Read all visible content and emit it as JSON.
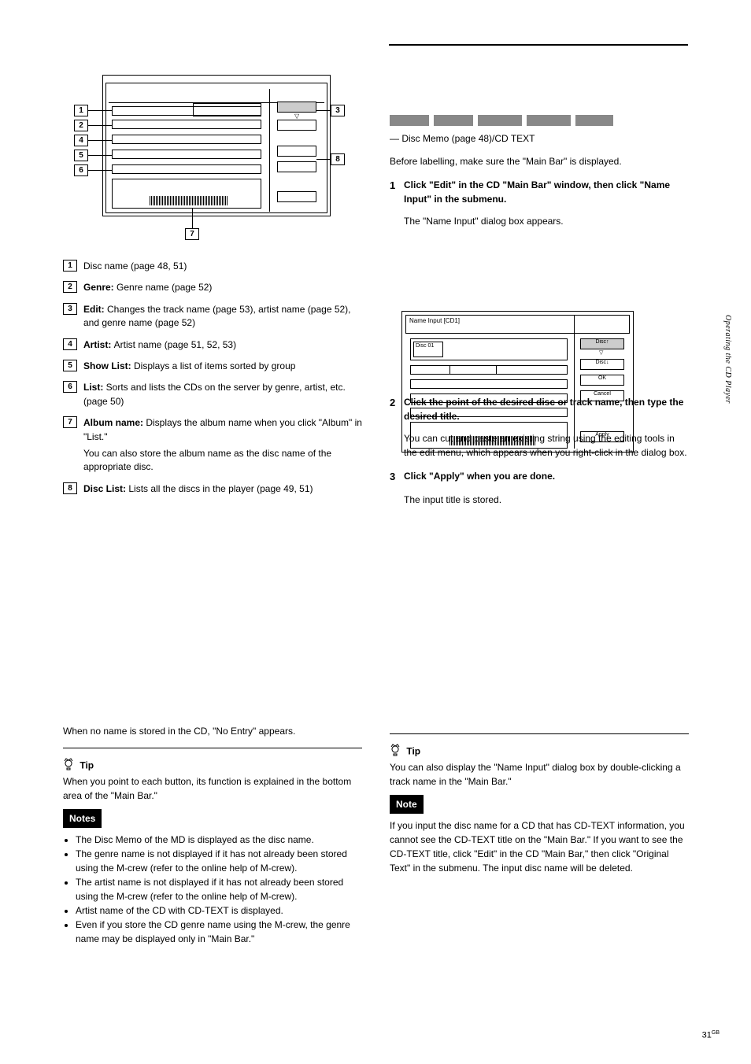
{
  "top_rule": true,
  "hidden_title_widths": [
    50,
    50,
    56,
    56,
    48
  ],
  "subtitle": "— Disc Memo (page 48)/CD TEXT",
  "left_diagram": {
    "side_chevron": "▽",
    "callouts": [
      "1",
      "2",
      "3",
      "4",
      "5",
      "6",
      "7",
      "8"
    ]
  },
  "desc": {
    "d1": "Disc name (page 48, 51)",
    "d2": {
      "bold": "Genre: ",
      "text": "Genre name (page 52)"
    },
    "d3": {
      "bold": "Edit: ",
      "text": "Changes the track name (page 53), artist name (page 52), and genre name (page 52)"
    },
    "d4": {
      "bold": "Artist: ",
      "text": "Artist name (page 51, 52, 53)"
    },
    "d5": {
      "bold": "Show List: ",
      "text": "Displays a list of items sorted by group"
    },
    "d6": {
      "bold": "List: ",
      "text": "Sorts and lists the CDs on the server by genre, artist, etc. (page 50)"
    },
    "d7": {
      "bold": "Album name: ",
      "text": "Displays the album name when you click \"Album\" in \"List.\""
    },
    "d7b": "You can also store the album name as the disc name of the appropriate disc.",
    "d8": {
      "bold": "Disc List: ",
      "text": "Lists all the discs in the player (page 49, 51)"
    }
  },
  "left_lower": {
    "none_text": "When no name is stored in the CD, \"No Entry\" appears.",
    "rule": true,
    "tip_label": "Tip",
    "tip_text": "When you point to each button, its function is explained in the bottom area of the \"Main Bar.\"",
    "note_label": "Notes",
    "note_bullets": [
      "The Disc Memo of the MD is displayed as the disc name.",
      "The genre name is not displayed if it has not already been stored using the M-crew (refer to the online help of M-crew).",
      "The artist name is not displayed if it has not already been stored using the M-crew (refer to the online help of M-crew).",
      "Artist name of the CD with CD-TEXT is displayed.",
      "Even if you store the CD genre name using the M-crew, the genre name may be displayed only in \"Main Bar.\""
    ]
  },
  "right_col": {
    "intro": "Before labelling, make sure the \"Main Bar\" is displayed.",
    "step1": {
      "n": "1",
      "text": "Click \"Edit\" in the CD \"Main Bar\" window, then click \"Name Input\" in the submenu."
    },
    "step1_after": "The \"Name Input\" dialog box appears.",
    "step2": {
      "n": "2",
      "text": "Click the point of the desired disc or track name, then type the desired title."
    },
    "step2_after": "You can cut and paste an existing string using the editing tools in the edit menu, which appears when you right-click in the dialog box.",
    "step3": {
      "n": "3",
      "text": "Click \"Apply\" when you are done."
    },
    "step3_after": "The input title is stored."
  },
  "small_diagram": {
    "header": "Name Input [CD1]",
    "disc_label": "Disc 01",
    "chevron": "▽",
    "buttons": [
      "Disc↑",
      "Disc↓",
      "OK",
      "Cancel",
      "Apply"
    ]
  },
  "right_lower": {
    "rule": true,
    "tip_label": "Tip",
    "tip_text": "You can also display the \"Name Input\" dialog box by double-clicking a track name in the \"Main Bar.\"",
    "note_label": "Note",
    "note_text": "If you input the disc name for a CD that has CD-TEXT information, you cannot see the CD-TEXT title on the \"Main Bar.\" If you want to see the CD-TEXT title, click \"Edit\" in the CD \"Main Bar,\" then click \"Original Text\" in the submenu. The input disc name will be deleted."
  },
  "sidebar": "Operating the CD Player",
  "page_number": "31",
  "page_suffix": "GB"
}
